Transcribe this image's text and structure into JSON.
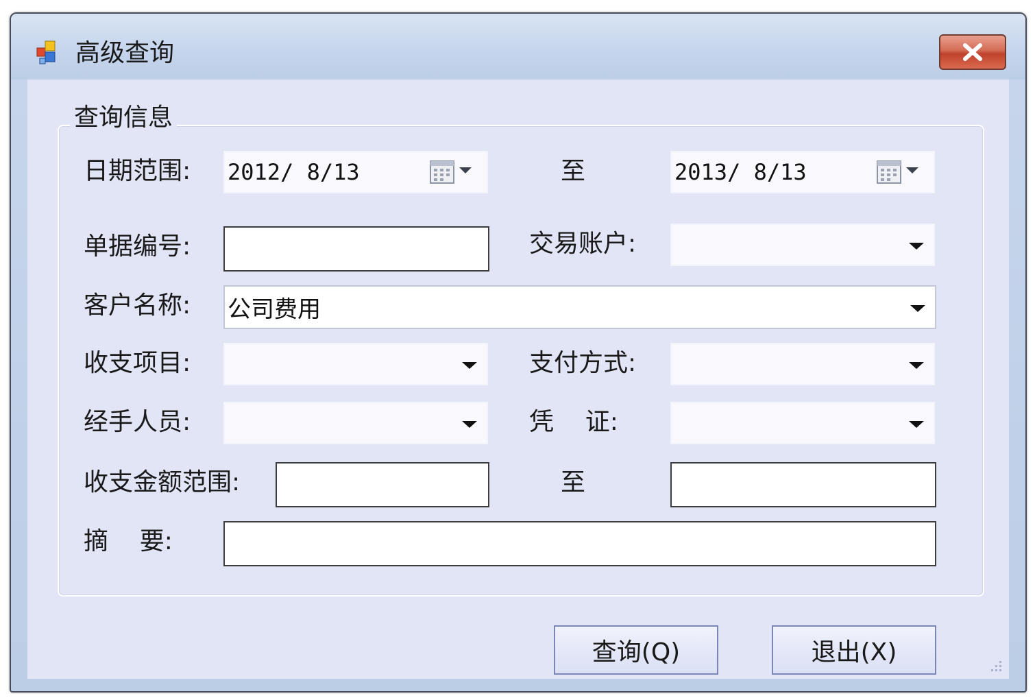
{
  "window": {
    "title": "高级查询",
    "close_icon": "close-icon"
  },
  "group": {
    "title": "查询信息"
  },
  "fields": {
    "date_range_label": "日期范围:",
    "date_from": "2012/ 8/13",
    "to_label_1": "至",
    "date_to": "2013/ 8/13",
    "doc_no_label": "单据编号:",
    "doc_no_value": "",
    "account_label": "交易账户:",
    "account_value": "",
    "customer_label": "客户名称:",
    "customer_value": "公司费用",
    "item_label": "收支项目:",
    "item_value": "",
    "pay_method_label": "支付方式:",
    "pay_method_value": "",
    "handler_label": "经手人员:",
    "handler_value": "",
    "voucher_label": "凭    证:",
    "voucher_value": "",
    "amount_range_label": "收支金额范围:",
    "amount_from": "",
    "to_label_2": "至",
    "amount_to": "",
    "summary_label": "摘    要:",
    "summary_value": ""
  },
  "buttons": {
    "query": "查询(Q)",
    "exit": "退出(X)"
  }
}
